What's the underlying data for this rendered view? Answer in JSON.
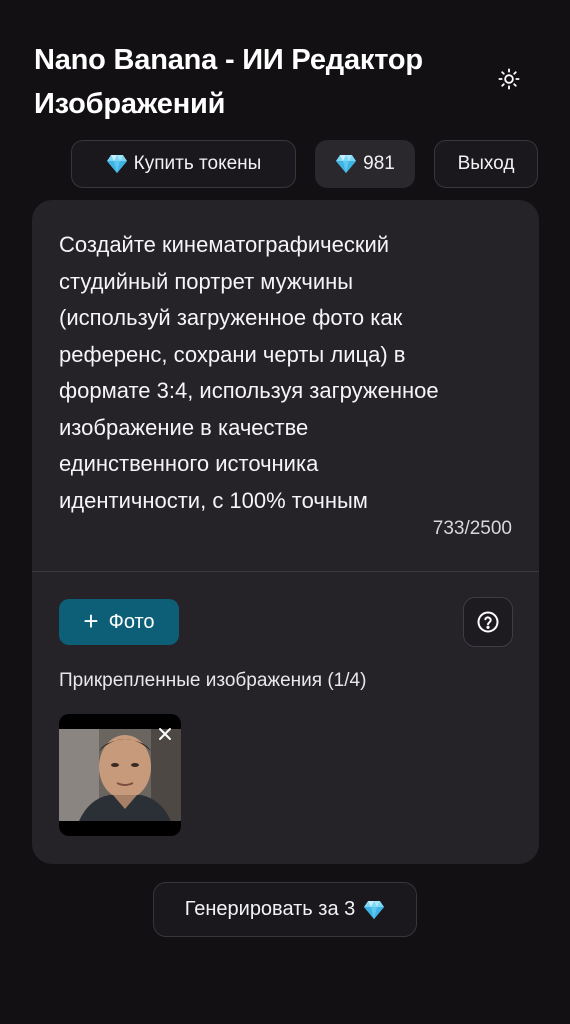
{
  "header": {
    "title": "Nano Banana - ИИ Редактор Изображений",
    "theme_icon": "sun-icon"
  },
  "toolbar": {
    "buy_label": "Купить токены",
    "balance_value": "981",
    "logout_label": "Выход",
    "gem_icon": "diamond-icon"
  },
  "prompt": {
    "text": "Создайте кинематографический\nстудийный портрет мужчины\n(используй загруженное фото как\nреференс, сохрани черты лица) в\nформате 3:4, используя загруженное\nизображение в качестве\nединственного источника\nидентичности, с 100% точным",
    "counter": "733/2500"
  },
  "attachments": {
    "photo_button_label": "Фото",
    "label": "Прикрепленные изображения (1/4)",
    "count": 1,
    "max": 4
  },
  "generate": {
    "label": "Генерировать за 3"
  },
  "colors": {
    "background": "#121013",
    "panel": "#252228",
    "accent": "#0d5f78"
  }
}
